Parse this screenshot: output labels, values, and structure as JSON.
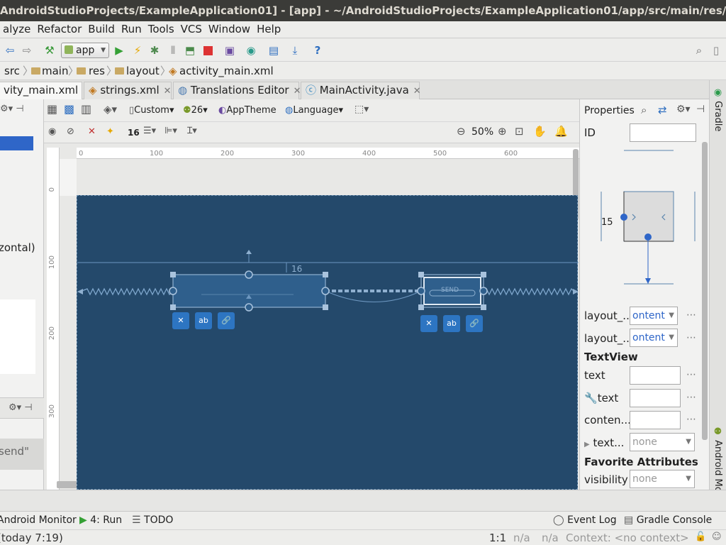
{
  "window": {
    "title": "AndroidStudioProjects/ExampleApplication01] - [app] - ~/AndroidStudioProjects/ExampleApplication01/app/src/main/res/layout/activity_ma"
  },
  "menu": {
    "items": [
      "alyze",
      "Refactor",
      "Build",
      "Run",
      "Tools",
      "VCS",
      "Window",
      "Help"
    ]
  },
  "toolbar": {
    "run_config": "app",
    "help_label": "?"
  },
  "breadcrumb": [
    "src",
    "main",
    "res",
    "layout",
    "activity_main.xml"
  ],
  "tabs": [
    {
      "label": "vity_main.xml",
      "active": true
    },
    {
      "label": "strings.xml",
      "active": false
    },
    {
      "label": "Translations Editor",
      "active": false
    },
    {
      "label": "MainActivity.java",
      "active": false
    }
  ],
  "design_toolbar": {
    "device": "Custom",
    "api": "26",
    "theme": "AppTheme",
    "language": "Language",
    "default_margin": "16",
    "zoom": "50%"
  },
  "ruler": {
    "h_ticks": [
      "0",
      "100",
      "200",
      "300",
      "400",
      "500",
      "600"
    ],
    "v_ticks": [
      "0",
      "100",
      "200",
      "300"
    ]
  },
  "canvas": {
    "margin_label": "16",
    "send_label": "SEND"
  },
  "left_panel": {
    "fragment_1": "zontal)",
    "fragment_2": "send\""
  },
  "properties": {
    "title": "Properties",
    "id_label": "ID",
    "margin_value": "15",
    "layout_width_label": "layout_...",
    "layout_width_value": "ontent",
    "layout_height_label": "layout_...",
    "layout_height_value": "ontent",
    "section_textview": "TextView",
    "text_label": "text",
    "text_tools_label": "text",
    "content_label": "conten...",
    "text_more_label": "text...",
    "text_more_value": "none",
    "section_favorites": "Favorite Attributes",
    "visibility_label": "visibility",
    "visibility_value": "none"
  },
  "side_tools": {
    "gradle": "Gradle",
    "android_model": "Android Model"
  },
  "status_tabs": {
    "android_monitor": "Android Monitor",
    "run": "4: Run",
    "todo": "TODO",
    "event_log": "Event Log",
    "gradle_console": "Gradle Console"
  },
  "bottom_status": {
    "message": "(today 7:19)",
    "position": "1:1",
    "na1": "n/a",
    "na2": "n/a",
    "context": "Context: <no context>"
  },
  "colors": {
    "screen_bg": "#24496b",
    "accent_blue": "#2f66c8"
  }
}
